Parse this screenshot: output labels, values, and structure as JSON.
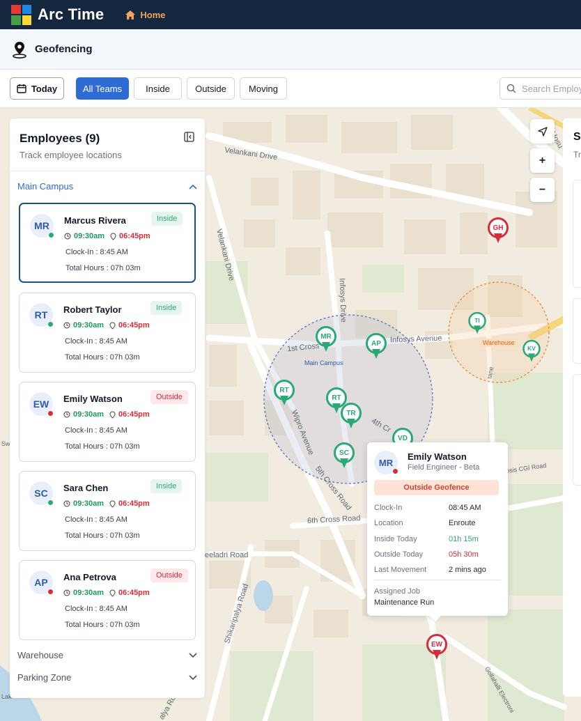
{
  "app": {
    "title": "Arc Time",
    "home_label": "Home",
    "logo_colors": [
      "#e53935",
      "#1e88e5",
      "#43a047",
      "#fdd835"
    ]
  },
  "page": {
    "title": "Geofencing"
  },
  "filters": {
    "today": "Today",
    "tabs": [
      "All Teams",
      "Inside",
      "Outside",
      "Moving"
    ],
    "active_tab": "All Teams",
    "search_placeholder": "Search Employ"
  },
  "colors": {
    "inside": "#2aa876",
    "outside": "#d62d3a",
    "primary": "#2f6bd4",
    "navbar": "#14273f"
  },
  "panel": {
    "title": "Employees (9)",
    "subtitle": "Track employee locations",
    "groups": {
      "main": "Main Campus",
      "warehouse": "Warehouse",
      "parking": "Parking Zone"
    },
    "employees": [
      {
        "initials": "MR",
        "name": "Marcus Rivera",
        "status": "Inside",
        "in": "09:30am",
        "out": "06:45pm",
        "clock_in": "Clock-In : 8:45 AM",
        "total": "Total Hours : 07h 03m"
      },
      {
        "initials": "RT",
        "name": "Robert Taylor",
        "status": "Inside",
        "in": "09:30am",
        "out": "06:45pm",
        "clock_in": "Clock-In : 8:45 AM",
        "total": "Total Hours : 07h 03m"
      },
      {
        "initials": "EW",
        "name": "Emily Watson",
        "status": "Outside",
        "in": "09:30am",
        "out": "06:45pm",
        "clock_in": "Clock-In : 8:45 AM",
        "total": "Total Hours : 07h 03m"
      },
      {
        "initials": "SC",
        "name": "Sara Chen",
        "status": "Inside",
        "in": "09:30am",
        "out": "06:45pm",
        "clock_in": "Clock-In : 8:45 AM",
        "total": "Total Hours : 07h 03m"
      },
      {
        "initials": "AP",
        "name": "Ana Petrova",
        "status": "Outside",
        "in": "09:30am",
        "out": "06:45pm",
        "clock_in": "Clock-In : 8:45 AM",
        "total": "Total Hours : 07h 03m"
      }
    ]
  },
  "map": {
    "streets": {
      "velankani_drive": "Velankani Drive",
      "velankani_drive_v": "Velankani Drive",
      "infosys_drive": "Infosys Drive",
      "infosys_avenue": "Infosys Avenue",
      "first_cross": "1st Cross",
      "wipro_avenue": "Wipro Avenue",
      "fourth_cross": "4th Cr",
      "fifth_cross": "5th Cross Road",
      "sixth_cross": "6th Cross Road",
      "neeladri": "eeladri Road",
      "shikaripalya": "Shikaripalya Road",
      "cgi_road": "osis CGI Road",
      "gollahalli": "Gollahalli Electroni",
      "hosur": "Hosu",
      "lake": "Lak",
      "sw": "Sw",
      "palya": "alya Ro",
      "tane": "tane"
    },
    "zones": {
      "main": "Main Campus",
      "warehouse": "Warehouse"
    },
    "pins": {
      "gh": "GH",
      "ti": "TI",
      "kv": "KV",
      "mr": "MR",
      "ap": "AP",
      "rt": "RT",
      "rt2": "RT",
      "tr": "TR",
      "sc": "SC",
      "vd": "VD",
      "ew": "EW"
    },
    "controls": {
      "zoom_in": "+",
      "zoom_out": "−"
    }
  },
  "right_panel": {
    "title_clip": "S",
    "sub_clip": "Tr"
  },
  "popup": {
    "initials": "MR",
    "name": "Emily Watson",
    "role": "Field Engineer - Beta",
    "status": "Outside Geofence",
    "rows": [
      {
        "k": "Clock-In",
        "v": "08:45 AM"
      },
      {
        "k": "Location",
        "v": "Enroute"
      },
      {
        "k": "Inside Today",
        "v": "01h 15m"
      },
      {
        "k": "Outside Today",
        "v": "05h 30m"
      },
      {
        "k": "Last Movement",
        "v": "2 mins ago"
      }
    ],
    "job_label": "Assigned Job",
    "job_value": "Maintenance Run"
  }
}
